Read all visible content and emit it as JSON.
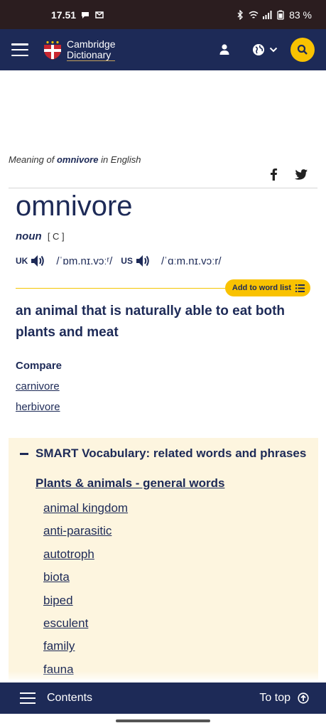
{
  "status": {
    "time": "17.51",
    "battery": "83 %"
  },
  "header": {
    "logo_line1": "Cambridge",
    "logo_line2": "Dictionary",
    "icons": [
      "menu-icon",
      "user-icon",
      "globe-icon",
      "chevron-down-icon",
      "search-icon"
    ]
  },
  "meaning": {
    "prefix": "Meaning of ",
    "word": "omnivore",
    "suffix": " in English"
  },
  "entry": {
    "headword": "omnivore",
    "pos": "noun",
    "grammar": "[ C ]",
    "uk_label": "UK",
    "uk_ipa": "/ˈɒm.nɪ.vɔːʳ/",
    "us_label": "US",
    "us_ipa": "/ˈɑːm.nɪ.vɔːr/",
    "add_to_word_list": "Add to word list",
    "definition": "an animal that is naturally able to eat both plants and meat"
  },
  "compare": {
    "heading": "Compare",
    "links": [
      "carnivore",
      "herbivore"
    ]
  },
  "smart": {
    "heading": "SMART Vocabulary: related words and phrases",
    "category": "Plants & animals - general words",
    "items": [
      "animal kingdom",
      "anti-parasitic",
      "autotroph",
      "biota",
      "biped",
      "esculent",
      "family",
      "fauna"
    ]
  },
  "bottom": {
    "contents": "Contents",
    "to_top": "To top"
  },
  "colors": {
    "navy": "#1d2a57",
    "yellow": "#f9c201",
    "cream": "#fdf5df"
  }
}
